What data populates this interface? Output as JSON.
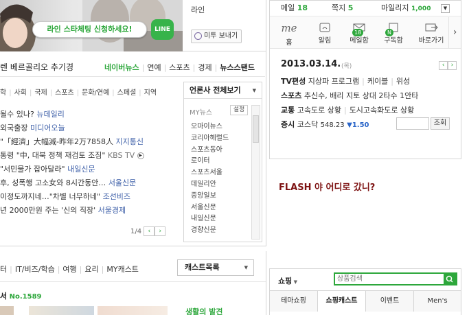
{
  "banner": {
    "pill": "라인 스타체팅 신청하세요!",
    "logo": "LINE"
  },
  "line_panel": {
    "title": "라인",
    "memo_btn": "미투 보내기"
  },
  "userbar": {
    "mail_label": "메일",
    "mail_count": "18",
    "note_label": "쪽지",
    "note_count": "5",
    "mileage_label": "마일리지",
    "mileage_value": "1,000"
  },
  "shortcuts": {
    "me_label": "홈",
    "items": [
      {
        "label": "알림",
        "icon": "wifi-icon"
      },
      {
        "label": "메일함",
        "icon": "mail-icon",
        "badge": "18"
      },
      {
        "label": "구독함",
        "icon": "subscribe-icon",
        "badge": "N"
      },
      {
        "label": "바로가기",
        "icon": "shortcut-icon"
      }
    ]
  },
  "today": {
    "date": "2013.03.14.",
    "day": "(목)",
    "rows": [
      {
        "cat": "TV편성",
        "items": [
          "지상파 프로그램",
          "케이블",
          "위성"
        ]
      },
      {
        "cat": "스포츠",
        "items": [
          "추신수, 배리 지토 상대 2타수 1안타"
        ]
      },
      {
        "cat": "교통",
        "items": [
          "고속도로 상황",
          "도시고속화도로 상황"
        ]
      }
    ],
    "stock_cat": "증시",
    "stock_name": "코스닥",
    "stock_value": "548.23",
    "stock_change": "▼1.50",
    "search_btn": "조회"
  },
  "flash_text": "FLASH 야 어디로 갔니?",
  "news": {
    "top_line": "렌 베르골리오 추기경",
    "tabs": [
      "네이버뉴스",
      "연예",
      "스포츠",
      "경제",
      "뉴스스탠드"
    ],
    "sub_tabs": [
      "학",
      "사회",
      "국제",
      "스포츠",
      "문화/연예",
      "스페셜",
      "지역"
    ],
    "headlines": [
      {
        "text": "될수 있나?",
        "src": "뉴데일리"
      },
      {
        "text": "  외국출장",
        "src": "미디어오늘"
      },
      {
        "text": "\"「經濟」大幅減-昨年2万7858人",
        "src": "지지통신"
      },
      {
        "text": "통령 \"中, 대북 정책 재검토 조짐\"",
        "src": "KBS TV"
      },
      {
        "text": "\"서민물가 잡아달라\"",
        "src": "내일신문"
      },
      {
        "text": "후, 성폭행 고소女와 8시간동안…",
        "src": "서울신문"
      },
      {
        "text": "이정도까지네…\"차별 너무하네\"",
        "src": "조선비즈"
      },
      {
        "text": "년 2000만원 주는 '신의 직장'",
        "src": "서울경제"
      }
    ],
    "page": "1/4",
    "press_btn": "언론사 전체보기",
    "my_news": "MY뉴스",
    "setting": "설정",
    "press_list": [
      "오마이뉴스",
      "코리아헤럴드",
      "스포츠동아",
      "로이터",
      "스포츠서울",
      "데일리안",
      "중앙일보",
      "서울신문",
      "내일신문",
      "경향신문"
    ]
  },
  "cast": {
    "tabs": [
      "터",
      "IT/비즈/학습",
      "여행",
      "요리",
      "MY캐스트"
    ],
    "btn": "캐스트목록",
    "no_prefix": "서",
    "no": "No.1589",
    "headline": "생활의 발견"
  },
  "shopping": {
    "label": "쇼핑",
    "placeholder": "상품검색",
    "tabs": [
      "테마쇼핑",
      "쇼핑캐스트",
      "이벤트",
      "Men's"
    ]
  },
  "colors": {
    "green": "#2da73b",
    "flash": "#7d1212",
    "link": "#3d5fa8"
  }
}
